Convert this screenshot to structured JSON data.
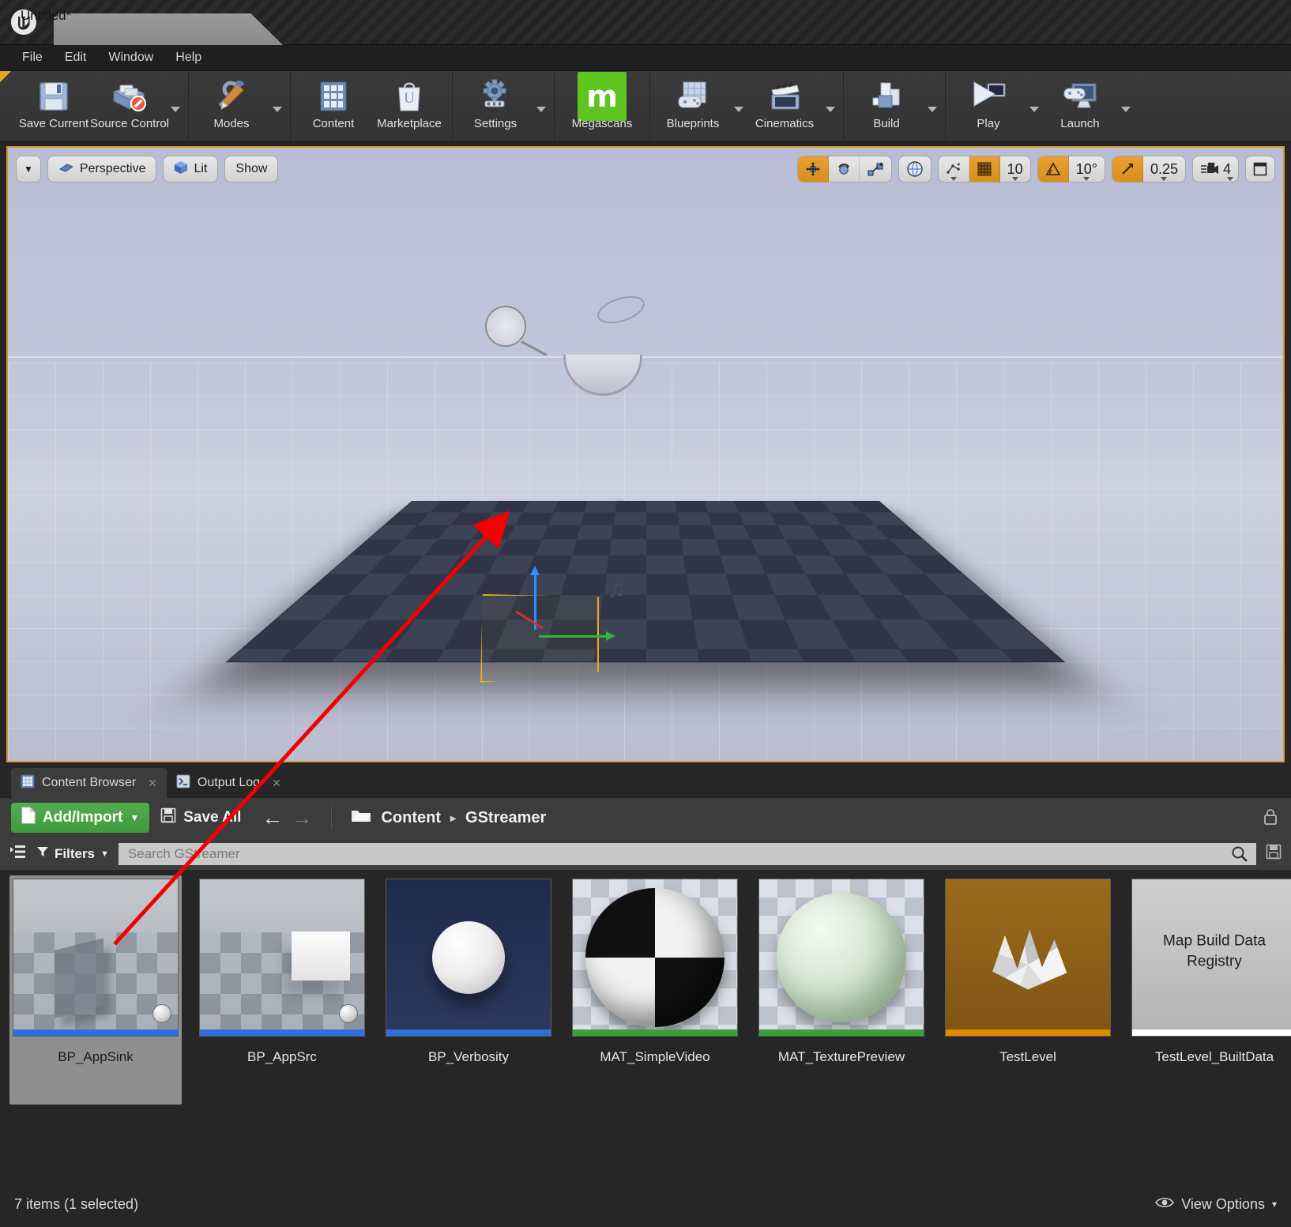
{
  "window": {
    "logo_glyph": "ư",
    "tab_title": "Untitled*"
  },
  "menubar": {
    "items": [
      {
        "label": "File"
      },
      {
        "label": "Edit"
      },
      {
        "label": "Window"
      },
      {
        "label": "Help"
      }
    ]
  },
  "toolbar": {
    "groups": [
      {
        "buttons": [
          {
            "label": "Save Current",
            "icon": "floppy-disk-icon",
            "caret": false
          },
          {
            "label": "Source Control",
            "icon": "source-control-icon",
            "caret": true
          }
        ]
      },
      {
        "buttons": [
          {
            "label": "Modes",
            "icon": "modes-wrench-icon",
            "caret": true
          }
        ]
      },
      {
        "buttons": [
          {
            "label": "Content",
            "icon": "content-grid-icon",
            "caret": false
          },
          {
            "label": "Marketplace",
            "icon": "marketplace-bag-icon",
            "caret": false
          }
        ]
      },
      {
        "buttons": [
          {
            "label": "Settings",
            "icon": "gear-icon",
            "caret": true
          }
        ]
      },
      {
        "buttons": [
          {
            "label": "Megascans",
            "icon": "megascans-icon",
            "caret": false
          }
        ]
      },
      {
        "buttons": [
          {
            "label": "Blueprints",
            "icon": "blueprints-icon",
            "caret": true
          },
          {
            "label": "Cinematics",
            "icon": "cinematics-clapper-icon",
            "caret": true
          }
        ]
      },
      {
        "buttons": [
          {
            "label": "Build",
            "icon": "build-icon",
            "caret": true
          }
        ]
      },
      {
        "buttons": [
          {
            "label": "Play",
            "icon": "play-icon",
            "caret": true
          },
          {
            "label": "Launch",
            "icon": "launch-icon",
            "caret": true
          }
        ]
      }
    ]
  },
  "viewport": {
    "left_controls": {
      "menu_caret": "▼",
      "perspective_label": "Perspective",
      "viewmode_label": "Lit",
      "show_label": "Show"
    },
    "right_controls": {
      "transform_modes": [
        {
          "name": "translate",
          "active": true
        },
        {
          "name": "rotate",
          "active": false
        },
        {
          "name": "scale",
          "active": false
        }
      ],
      "coord_system": "world",
      "surface_snap_active": false,
      "grid_snap_active": true,
      "grid_snap_value": "10",
      "rotation_snap_active": true,
      "rotation_snap_value": "10°",
      "scale_snap_active": true,
      "scale_snap_value": "0.25",
      "camera_speed_value": "4",
      "maximize_icon": "maximize-viewport-icon"
    },
    "axes": {
      "z": "Z",
      "x": "X",
      "y": "Y"
    }
  },
  "dock": {
    "tabs": [
      {
        "label": "Content Browser",
        "icon": "content-browser-icon",
        "active": true,
        "close": "✕"
      },
      {
        "label": "Output Log",
        "icon": "output-log-icon",
        "active": false,
        "close": "✕"
      }
    ]
  },
  "content_browser": {
    "add_import_label": "Add/Import",
    "add_import_caret": "▼",
    "save_all_label": "Save All",
    "back_arrow": "←",
    "forward_arrow": "→",
    "breadcrumb": [
      "Content",
      "GStreamer"
    ],
    "breadcrumb_sep": "▸",
    "lock_icon": "lock-icon",
    "filters_label": "Filters",
    "filters_caret": "▼",
    "search_placeholder": "Search GStreamer",
    "search_value": "",
    "search_icon": "search-icon",
    "sources_icon": "sources-panel-icon",
    "save_search_icon": "save-search-icon",
    "assets": [
      {
        "name": "BP_AppSink",
        "type": "blueprint",
        "bar_color": "#2f6fdb",
        "selected": true
      },
      {
        "name": "BP_AppSrc",
        "type": "blueprint",
        "bar_color": "#2f6fdb",
        "selected": false
      },
      {
        "name": "BP_Verbosity",
        "type": "blueprint-dark",
        "bar_color": "#2f6fdb",
        "selected": false
      },
      {
        "name": "MAT_SimpleVideo",
        "type": "material",
        "bar_color": "#3aa13a",
        "selected": false
      },
      {
        "name": "MAT_TexturePreview",
        "type": "material-green",
        "bar_color": "#3aa13a",
        "selected": false
      },
      {
        "name": "TestLevel",
        "type": "level",
        "bar_color": "#e08a00",
        "selected": false
      },
      {
        "name": "TestLevel_BuiltData",
        "type": "builtdata",
        "bar_color": "#ffffff",
        "selected": false,
        "thumb_text": "Map Build Data Registry"
      }
    ],
    "status_text": "7 items (1 selected)",
    "view_options_label": "View Options",
    "view_options_icon": "eye-icon",
    "view_options_caret": "▾"
  },
  "annotation": {
    "arrow_color": "#f50000"
  },
  "colors": {
    "accent_orange": "#d89b2a",
    "add_import_green": "#4aa348",
    "megascans_green": "#5ec41f",
    "selection_box": "#f0a81c"
  }
}
